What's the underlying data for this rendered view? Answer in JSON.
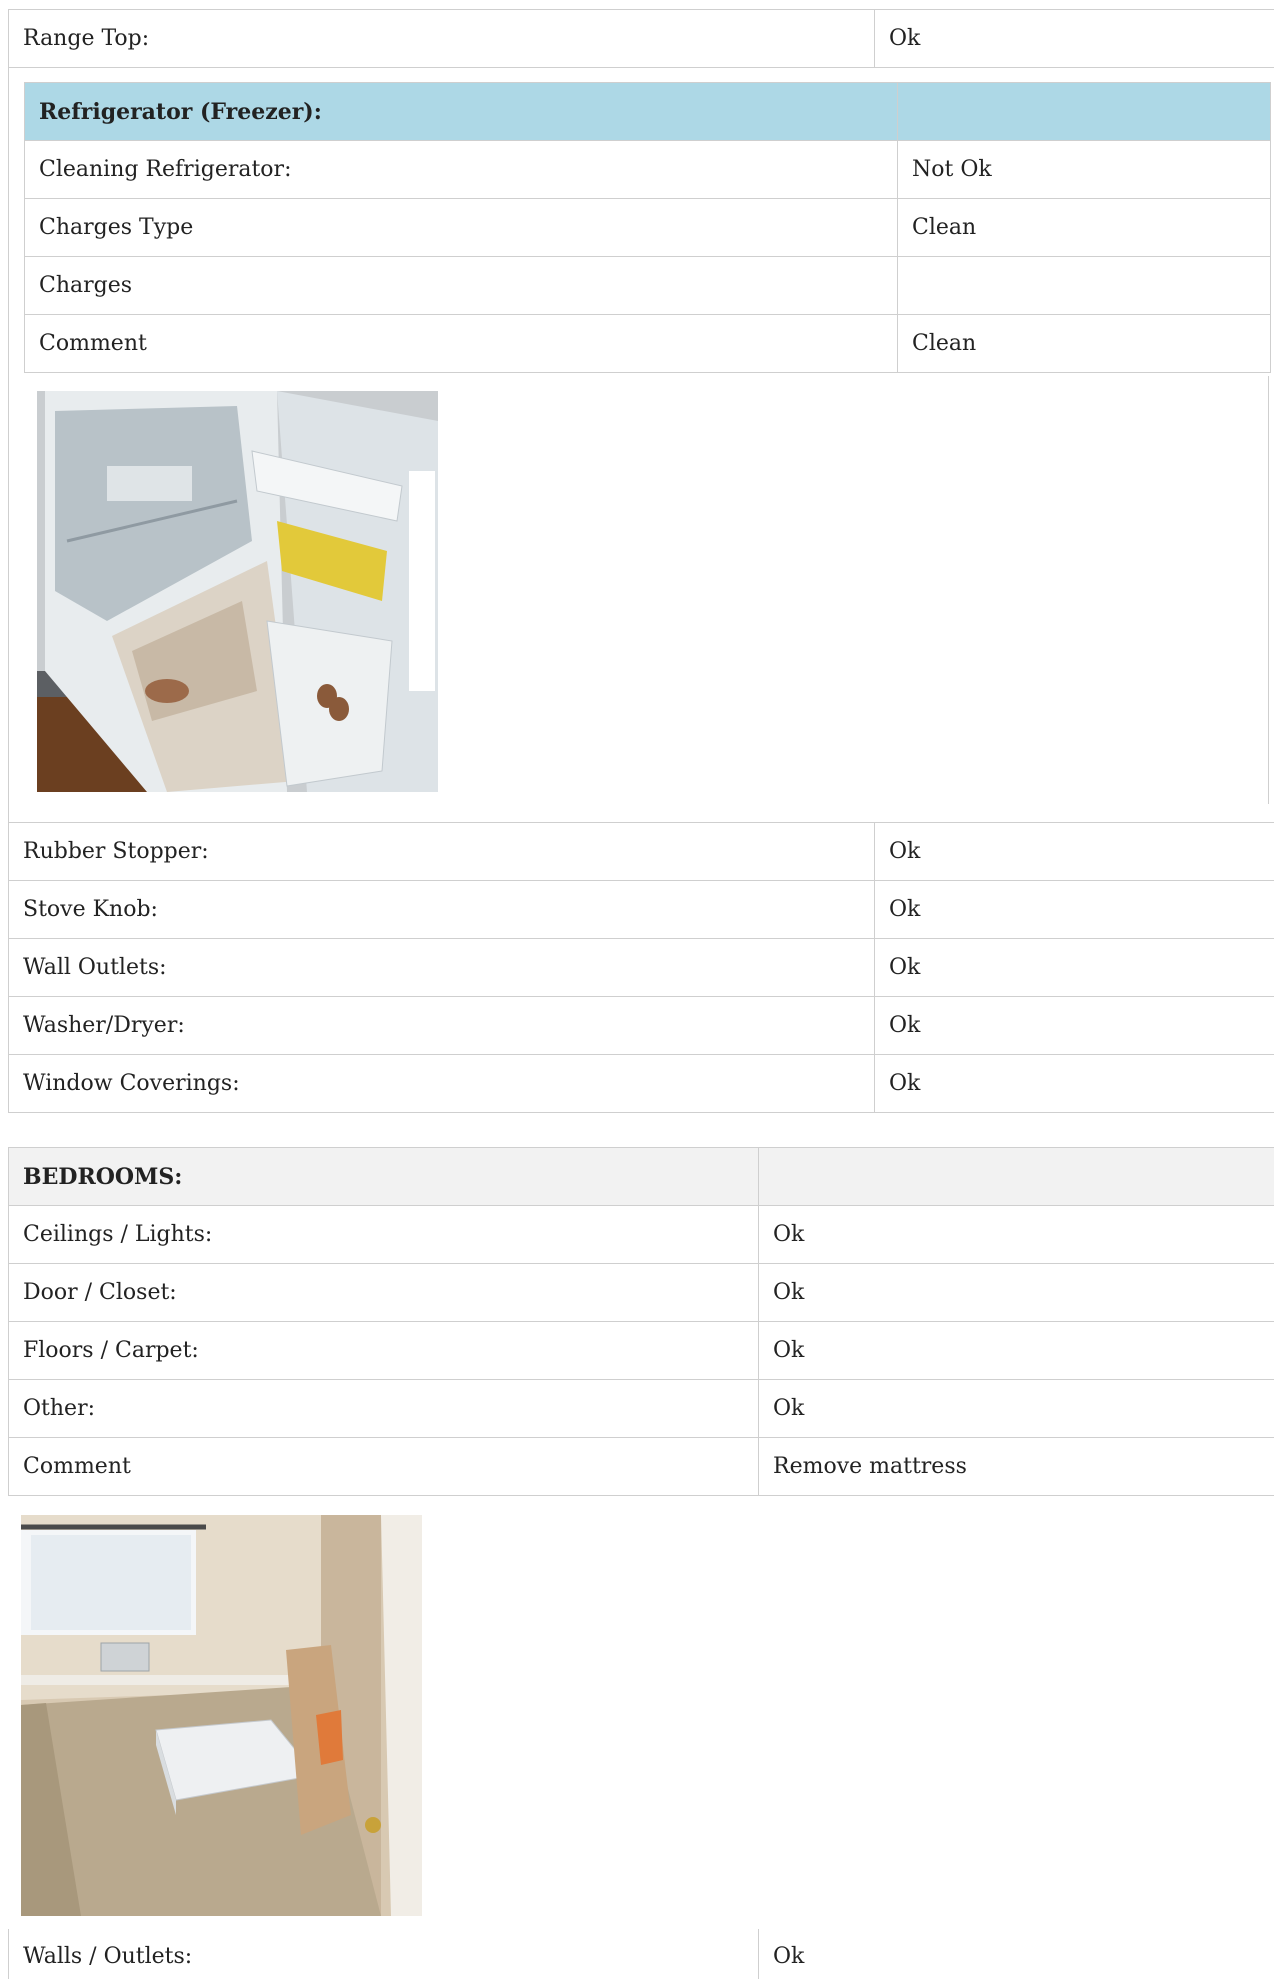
{
  "range_top": {
    "label": "Range Top:",
    "value": "Ok"
  },
  "refrigerator": {
    "title": "Refrigerator (Freezer):",
    "rows": [
      {
        "label": "Cleaning Refrigerator:",
        "value": "Not Ok"
      },
      {
        "label": "Charges Type",
        "value": "Clean"
      },
      {
        "label": "Charges",
        "value": ""
      },
      {
        "label": "Comment",
        "value": "Clean"
      }
    ]
  },
  "kitchen_rows": [
    {
      "label": "Rubber Stopper:",
      "value": "Ok"
    },
    {
      "label": "Stove Knob:",
      "value": "Ok"
    },
    {
      "label": "Wall Outlets:",
      "value": "Ok"
    },
    {
      "label": "Washer/Dryer:",
      "value": "Ok"
    },
    {
      "label": "Window Coverings:",
      "value": "Ok"
    }
  ],
  "bedrooms": {
    "title": "BEDROOMS:",
    "rows": [
      {
        "label": "Ceilings / Lights:",
        "value": "Ok"
      },
      {
        "label": "Door / Closet:",
        "value": "Ok"
      },
      {
        "label": "Floors / Carpet:",
        "value": "Ok"
      },
      {
        "label": "Other:",
        "value": "Ok"
      },
      {
        "label": "Comment",
        "value": "Remove mattress"
      }
    ],
    "walls": {
      "label": "Walls / Outlets:",
      "value": "Ok"
    }
  }
}
